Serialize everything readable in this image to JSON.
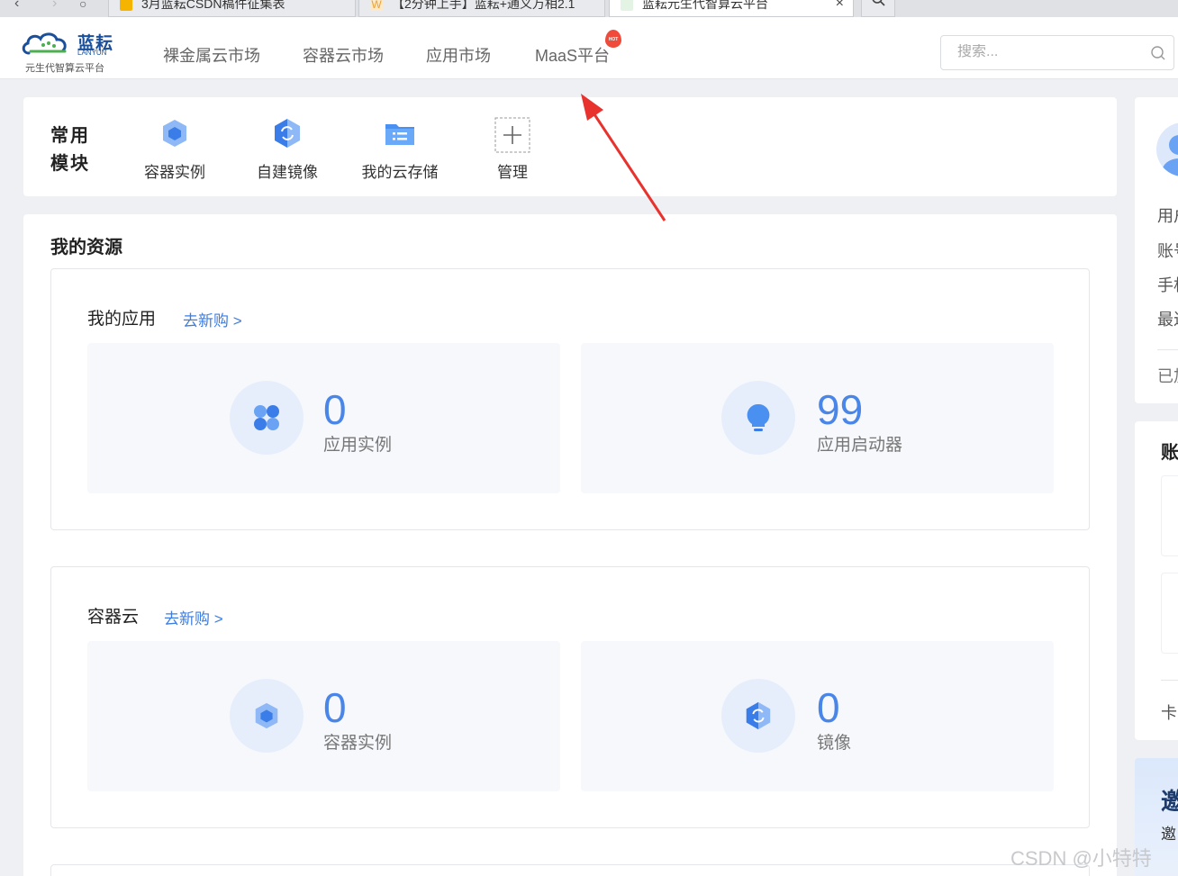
{
  "browser": {
    "tabs": [
      {
        "title": "3月蓝耘CSDN稿件征集表",
        "favicon_color": "#f5b400"
      },
      {
        "title": "【2分钟上手】蓝耘+通义万相2.1",
        "favicon_color": "#e8a33b"
      },
      {
        "title": "蓝耘元生代智算云平台",
        "favicon_color": "#4caf50"
      }
    ]
  },
  "header": {
    "logo": {
      "name": "蓝耘",
      "en": "LANYUN",
      "subtitle": "元生代智算云平台"
    },
    "nav": [
      "裸金属云市场",
      "容器云市场",
      "应用市场",
      "MaaS平台"
    ],
    "hot_badge": "HOT",
    "search_placeholder": "搜索..."
  },
  "modules": {
    "title": "常用模块",
    "items": [
      {
        "label": "容器实例",
        "icon": "cube-icon"
      },
      {
        "label": "自建镜像",
        "icon": "mirror-icon"
      },
      {
        "label": "我的云存储",
        "icon": "folder-icon"
      },
      {
        "label": "管理",
        "icon": "plus-icon"
      }
    ]
  },
  "resources": {
    "title": "我的资源",
    "sections": [
      {
        "title": "我的应用",
        "link": "去新购 >",
        "stats": [
          {
            "value": "0",
            "label": "应用实例",
            "icon": "grid-icon"
          },
          {
            "value": "99",
            "label": "应用启动器",
            "icon": "bulb-icon"
          }
        ]
      },
      {
        "title": "容器云",
        "link": "去新购 >",
        "stats": [
          {
            "value": "0",
            "label": "容器实例",
            "icon": "cube-icon"
          },
          {
            "value": "0",
            "label": "镜像",
            "icon": "mirror-icon"
          }
        ]
      }
    ]
  },
  "side": {
    "user_lines": [
      "用户",
      "账号",
      "手机",
      "最近"
    ],
    "status_line": "已加",
    "account_title": "账",
    "card_line": "卡",
    "invite_title": "邀",
    "invite_text": "邀"
  },
  "watermark": "CSDN @小特特",
  "colors": {
    "accent": "#4a86e8",
    "link": "#3d7de0",
    "arrow": "#e8322e"
  }
}
